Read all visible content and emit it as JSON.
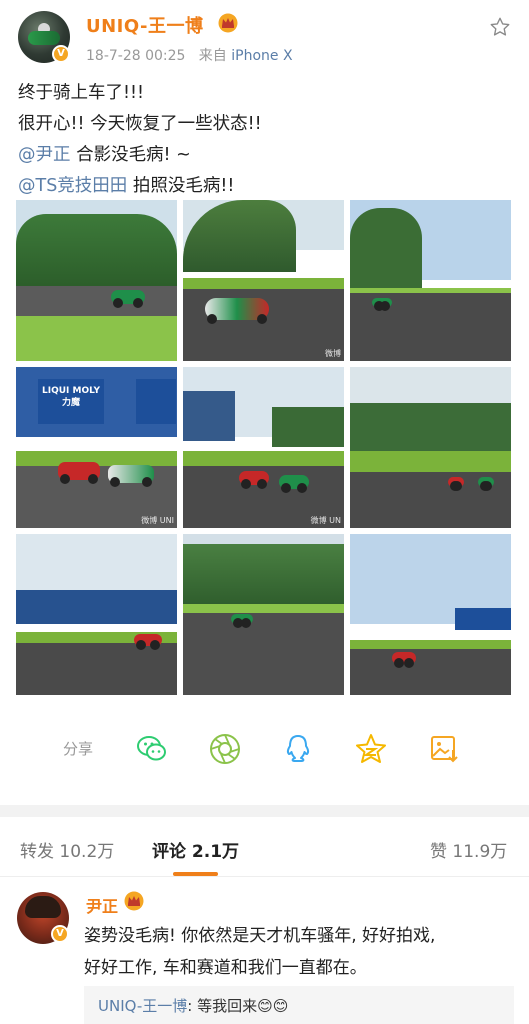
{
  "post": {
    "username": "UNIQ-王一博",
    "time": "18-7-28 00:25",
    "source_prefix": "来自",
    "source": "iPhone X",
    "verified_badge": "V",
    "lines": [
      "终于骑上车了!!!",
      "很开心!! 今天恢复了一些状态!!"
    ],
    "mention1": "@尹正",
    "mention1_text": " 合影没毛病! ~",
    "mention2": "@TS竞技田田",
    "mention2_text": " 拍照没毛病!!",
    "photos": [
      {
        "scene": "motorcycle on track grass",
        "watermark": ""
      },
      {
        "scene": "motorcycle leaning on track",
        "watermark": "微博"
      },
      {
        "scene": "distant rider on track",
        "watermark": ""
      },
      {
        "scene": "two riders with LIQUI MOLY billboard",
        "billboard": "LIQUI MOLY 力魔",
        "watermark": "微博 UNI"
      },
      {
        "scene": "two riders high five",
        "watermark": "微博 UN"
      },
      {
        "scene": "two riders on turn",
        "watermark": ""
      },
      {
        "scene": "rider in front of billboard",
        "watermark": ""
      },
      {
        "scene": "rider leaning into corner",
        "watermark": ""
      },
      {
        "scene": "rider with billboards far",
        "watermark": ""
      }
    ]
  },
  "share": {
    "label": "分享",
    "icons": [
      "wechat-icon",
      "moments-icon",
      "qq-icon",
      "qzone-icon",
      "save-image-icon"
    ]
  },
  "tabs": {
    "repost_label": "转发",
    "repost_count": "10.2万",
    "comment_label": "评论",
    "comment_count": "2.1万",
    "like_label": "赞",
    "like_count": "11.9万"
  },
  "comment": {
    "username": "尹正",
    "verified_badge": "V",
    "lines": [
      "姿势没毛病! 你依然是天才机车骚年, 好好拍戏,",
      "好好工作, 车和赛道和我们一直都在。"
    ],
    "reply_name": "UNIQ-王一博",
    "reply_text": ": 等我回来😊😊"
  },
  "colors": {
    "accent": "#ef7f1a",
    "link": "#5b7ea8",
    "muted": "#999999"
  }
}
